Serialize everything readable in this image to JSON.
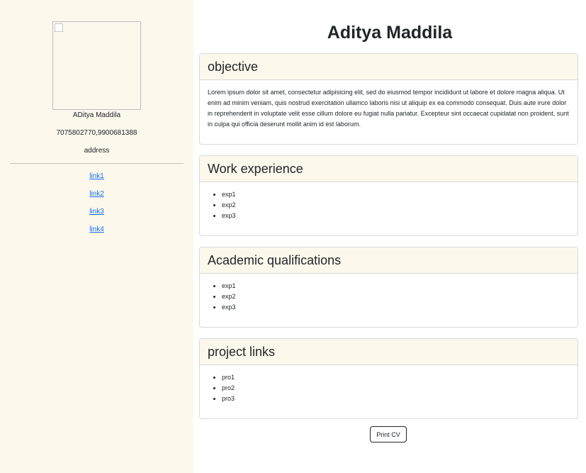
{
  "sidebar": {
    "name": "ADitya Maddila",
    "phones": "7075802770,9900681388",
    "address": "address",
    "links": [
      "link1",
      "link2",
      "link3",
      "link4"
    ]
  },
  "header": {
    "title": "Aditya Maddila"
  },
  "sections": {
    "objective": {
      "title": "objective",
      "text": "Lorem ipsum dolor sit amet, consectetur adipisicing elit, sed do eiusmod tempor incididunt ut labore et dolore magna aliqua. Ut enim ad minim veniam, quis nostrud exercitation ullamco laboris nisi ut aliquip ex ea commodo consequat. Duis aute irure dolor in reprehenderit in voluptate velit esse cillum dolore eu fugiat nulla pariatur. Excepteur sint occaecat cupidatat non proident, sunt in culpa qui officia deserunt mollit anim id est laborum."
    },
    "work": {
      "title": "Work experience",
      "items": [
        "exp1",
        "exp2",
        "exp3"
      ]
    },
    "academic": {
      "title": "Academic qualifications",
      "items": [
        "exp1",
        "exp2",
        "exp3"
      ]
    },
    "projects": {
      "title": "project links",
      "items": [
        "pro1",
        "pro2",
        "pro3"
      ]
    }
  },
  "actions": {
    "print_label": "Print CV"
  }
}
